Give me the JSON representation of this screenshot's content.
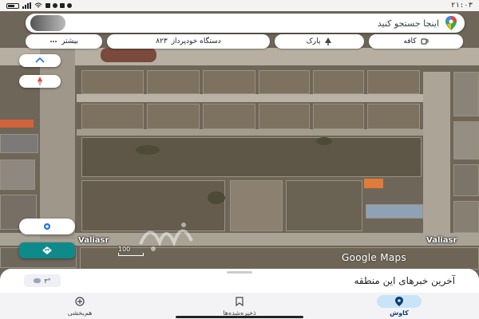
{
  "status_bar": {
    "time": "۲۱:۰۳",
    "icons": [
      "battery-icon",
      "signal-icon",
      "wifi-icon",
      "notification-icons"
    ]
  },
  "search": {
    "placeholder": "اینجا جستجو کنید",
    "icons": [
      "google-maps-logo-icon",
      "microphone-icon"
    ]
  },
  "chips": [
    {
      "label": "کافه",
      "icon": "cup-icon"
    },
    {
      "label": "پارک",
      "icon": "tree-icon"
    },
    {
      "label": "دستگاه خودپرداز",
      "prefix": "۸۲۳",
      "icon": "atm-icon"
    },
    {
      "label": "بیشتر",
      "icon": "more-dots-icon"
    }
  ],
  "map": {
    "street_label_left": "Valiasr",
    "street_label_right": "Valiasr",
    "attribution": "Google Maps",
    "scale_label": "100"
  },
  "controls": [
    "layers-icon",
    "compass-icon",
    "my-location-icon",
    "directions-icon"
  ],
  "bottom_sheet": {
    "title": "آخرین خبرهای این منطقه",
    "weather": "۳°"
  },
  "nav": [
    {
      "label": "کاوش",
      "icon": "explore-pin-icon",
      "active": true
    },
    {
      "label": "ذخیره‌شده‌ها",
      "icon": "bookmark-icon",
      "active": false
    },
    {
      "label": "هم‌بخشی",
      "icon": "add-circle-icon",
      "active": false
    }
  ],
  "colors": {
    "accent": "#1a73e8",
    "nav_active_bg": "#c9e4f9",
    "map_bg": "#6f665a"
  }
}
